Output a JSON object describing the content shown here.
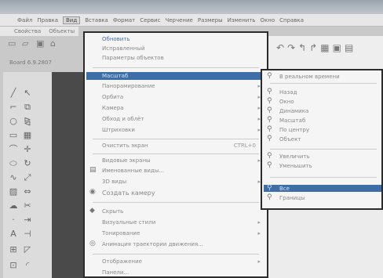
{
  "menubar": {
    "items": [
      "Файл",
      "Правка",
      "Вид",
      "Вставка",
      "Формат",
      "Сервис",
      "Черчение",
      "Размеры",
      "Изменить",
      "Окно",
      "Справка"
    ],
    "active_index": 2
  },
  "submenubar": {
    "items": [
      "Свойства",
      "Объекты"
    ]
  },
  "datebox": {
    "text": "Board 6.9.2807"
  },
  "view_menu": {
    "items": [
      {
        "label": "Обновить",
        "blue": true
      },
      {
        "label": "Исправленный",
        "blue": false
      },
      {
        "label": "Параметры объектов",
        "blue": false
      },
      {
        "label": "Масштаб",
        "blue": false,
        "highlight": true
      },
      {
        "label": "Панорамирование",
        "blue": false,
        "arrow": true
      },
      {
        "label": "Орбита",
        "blue": false,
        "arrow": true
      },
      {
        "label": "Камера",
        "blue": false,
        "arrow": true
      },
      {
        "label": "Обход и облёт",
        "blue": false,
        "arrow": true
      },
      {
        "label": "Штриховки",
        "blue": false,
        "arrow": true
      },
      {
        "label": "Очистить экран",
        "blue": false,
        "shortcut": "CTRL+0"
      },
      {
        "label": "Видовые экраны",
        "blue": false,
        "arrow": true
      },
      {
        "label": "Именованные виды...",
        "blue": false
      },
      {
        "label": "3D виды",
        "blue": false,
        "arrow": true
      },
      {
        "label": "Создать камеру",
        "blue": false
      },
      {
        "label": "Скрыть",
        "blue": false
      },
      {
        "label": "Визуальные стили",
        "blue": false,
        "arrow": true
      },
      {
        "label": "Тонирование",
        "blue": false,
        "arrow": true
      },
      {
        "label": "Анимация траектории движения...",
        "blue": false
      },
      {
        "label": "Отображение",
        "blue": false,
        "arrow": true
      },
      {
        "label": "Панели...",
        "blue": false
      }
    ]
  },
  "zoom_submenu": {
    "items": [
      {
        "label": "В реальном времени",
        "blue": false
      },
      {
        "label": "Назад",
        "blue": false
      },
      {
        "label": "Окно",
        "blue": false
      },
      {
        "label": "Динамика",
        "blue": false
      },
      {
        "label": "Масштаб",
        "blue": false
      },
      {
        "label": "По центру",
        "blue": false
      },
      {
        "label": "Объект",
        "blue": false
      },
      {
        "label": "Увеличить",
        "blue": false
      },
      {
        "label": "Уменьшить",
        "blue": false
      },
      {
        "label": "Все",
        "blue": false,
        "highlight": true
      },
      {
        "label": "Границы",
        "blue": false
      }
    ]
  },
  "colors": {
    "highlight": "#3d6ea8",
    "border": "#2b2b2b"
  }
}
